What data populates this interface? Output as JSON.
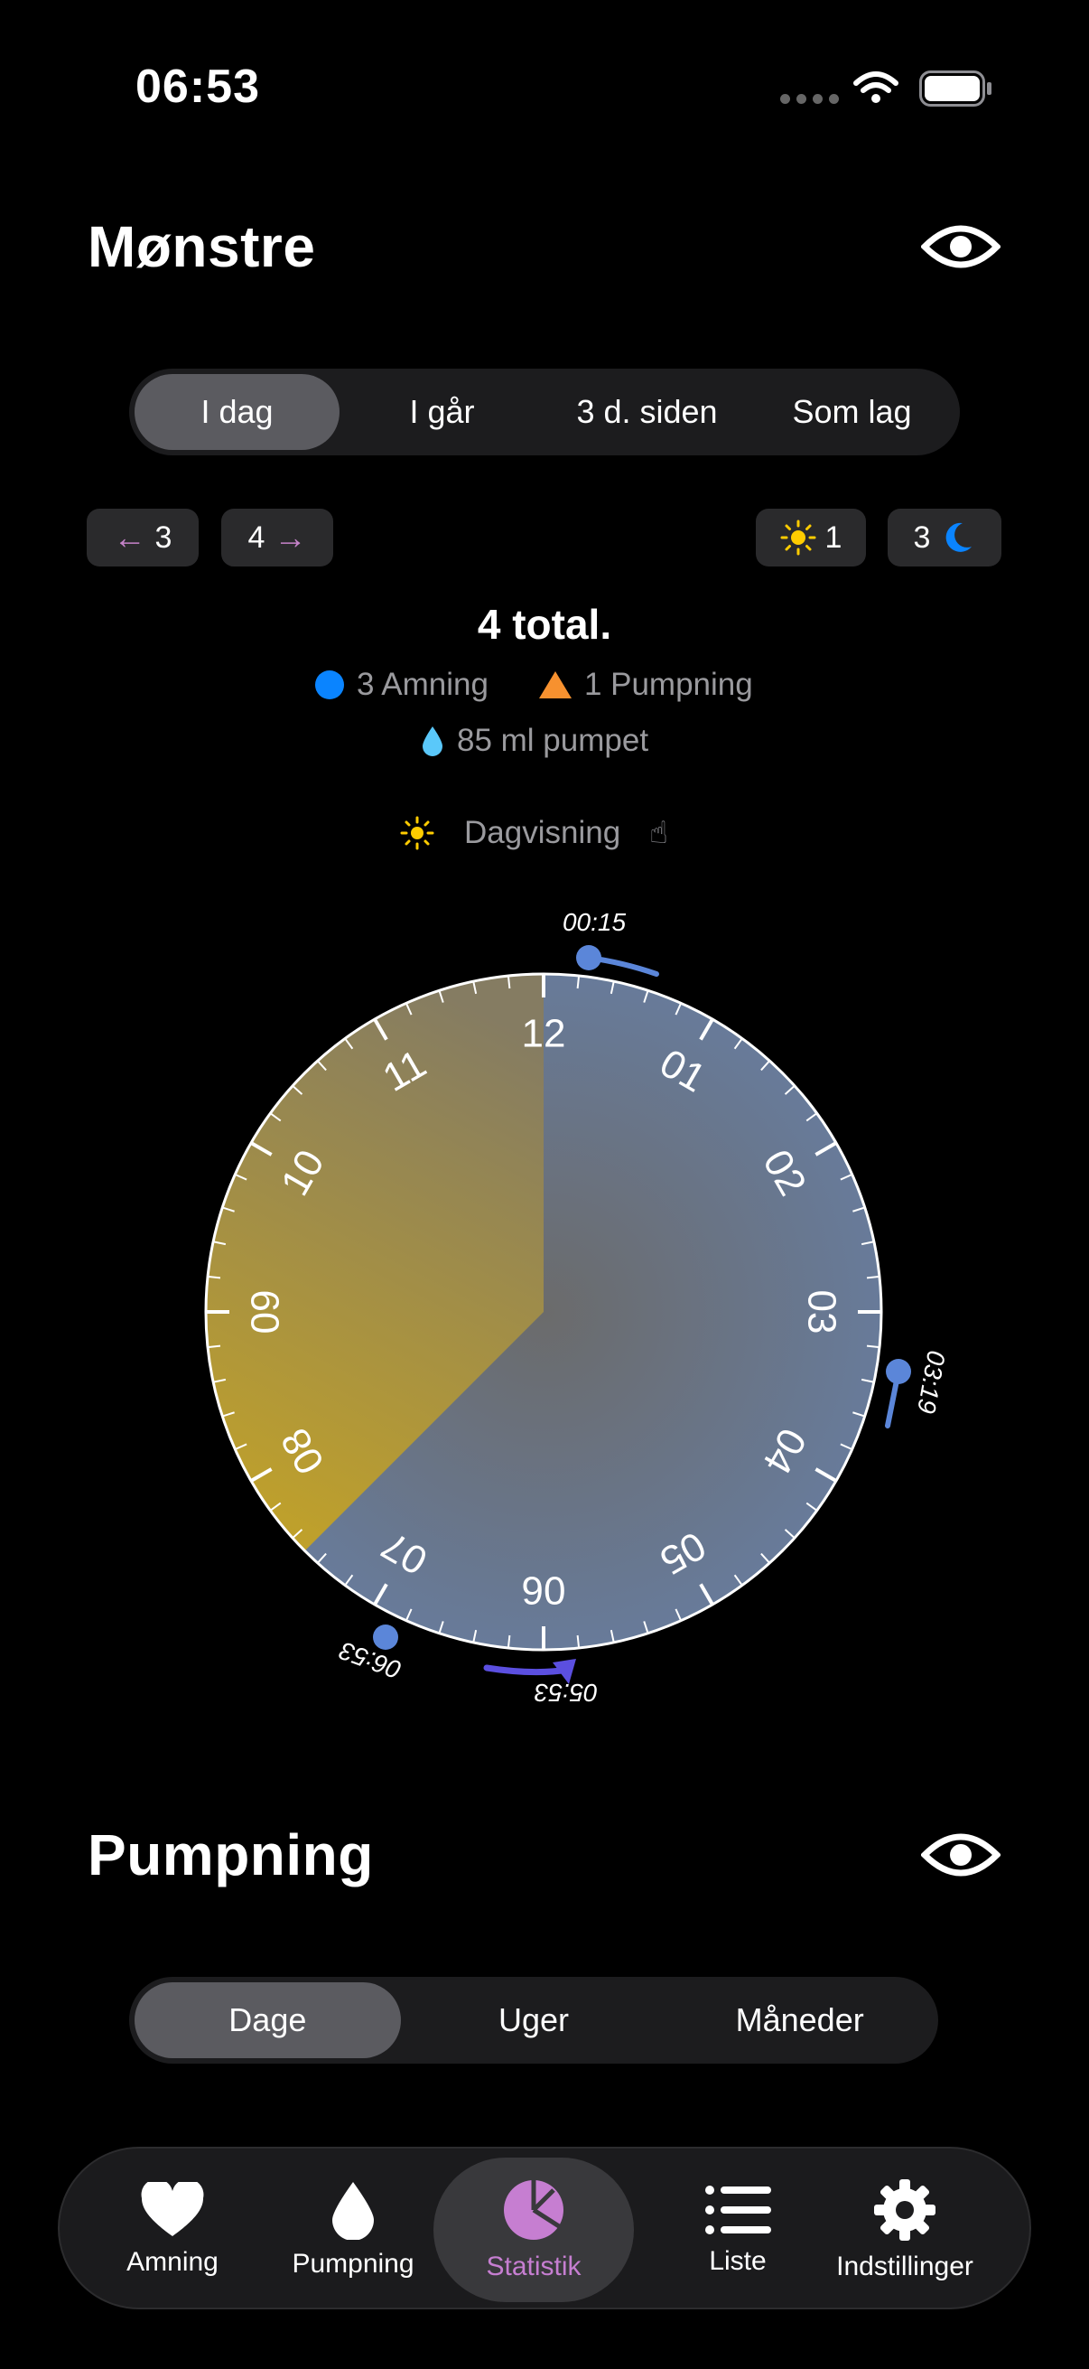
{
  "status_bar": {
    "time": "06:53"
  },
  "patterns": {
    "title": "Mønstre",
    "eye_icon": "eye-icon",
    "segments": [
      "I dag",
      "I går",
      "3 d. siden",
      "Som lag"
    ],
    "active_segment": 0,
    "nav_prev": "3",
    "nav_next": "4",
    "day_count": "1",
    "night_count": "3",
    "total_text": "4 total.",
    "breastfeeding_text": "3 Amning",
    "pumping_text": "1 Pumpning",
    "pumped_text": "85 ml pumpet",
    "view_label": "Dagvisning",
    "clock": {
      "hour_labels": [
        "12",
        "01",
        "02",
        "03",
        "04",
        "05",
        "06",
        "07",
        "08",
        "09",
        "10",
        "11"
      ],
      "event_labels": [
        "00:15",
        "03:19",
        "05:53",
        "06:53"
      ],
      "day_color": "#b49f2f",
      "night_color": "#6a7e9e",
      "event_color": "#5b86d9",
      "pump_color": "#5b4fe0"
    }
  },
  "pumping": {
    "title": "Pumpning",
    "segments": [
      "Dage",
      "Uger",
      "Måneder"
    ],
    "active_segment": 0
  },
  "tabbar": {
    "tabs": [
      {
        "label": "Amning",
        "icon": "heart-icon"
      },
      {
        "label": "Pumpning",
        "icon": "drop-icon"
      },
      {
        "label": "Statistik",
        "icon": "pie-chart-icon",
        "active": true
      },
      {
        "label": "Liste",
        "icon": "list-icon"
      },
      {
        "label": "Indstillinger",
        "icon": "gear-icon"
      }
    ],
    "active_color": "#c67ed1"
  }
}
